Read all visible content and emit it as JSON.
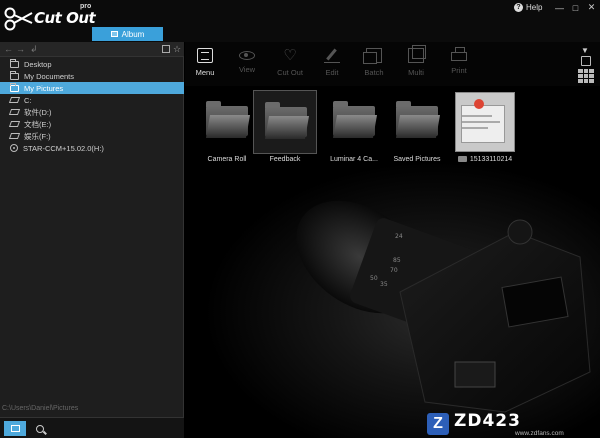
{
  "app": {
    "name": "Cut Out",
    "edition": "pro",
    "album_tab": "Album",
    "help": "Help"
  },
  "window_buttons": [
    "—",
    "□",
    "✕"
  ],
  "sidebar": {
    "items": [
      {
        "label": "Desktop",
        "icon": "folder-icon"
      },
      {
        "label": "My Documents",
        "icon": "folder-icon"
      },
      {
        "label": "My Pictures",
        "icon": "folder-icon",
        "selected": true
      },
      {
        "label": "C:",
        "icon": "drive-icon"
      },
      {
        "label": "软件(D:)",
        "icon": "drive-icon"
      },
      {
        "label": "文档(E:)",
        "icon": "drive-icon"
      },
      {
        "label": "娱乐(F:)",
        "icon": "drive-icon"
      },
      {
        "label": "STAR-CCM+15.02.0(H:)",
        "icon": "disc-icon"
      }
    ],
    "path": "C:\\Users\\Daniel\\Pictures"
  },
  "toolbar": {
    "items": [
      {
        "label": "Menu",
        "active": true
      },
      {
        "label": "View",
        "active": false
      },
      {
        "label": "Cut Out",
        "active": false
      },
      {
        "label": "Edit",
        "active": false
      },
      {
        "label": "Batch",
        "active": false
      },
      {
        "label": "Multi",
        "active": false
      },
      {
        "label": "Print",
        "active": false
      }
    ]
  },
  "thumbnails": [
    {
      "caption": "Camera Roll",
      "type": "folder"
    },
    {
      "caption": "Feedback",
      "type": "folder",
      "selected": true
    },
    {
      "caption": "Luminar 4 Ca...",
      "type": "folder"
    },
    {
      "caption": "Saved Pictures",
      "type": "folder"
    },
    {
      "caption": "15133110214",
      "type": "image"
    }
  ],
  "watermark": {
    "logo": "Z",
    "text": "ZD423",
    "url": "www.zdfans.com"
  },
  "colors": {
    "accent": "#3aa0da",
    "selection": "#4ea9dc",
    "background": "#000000"
  }
}
